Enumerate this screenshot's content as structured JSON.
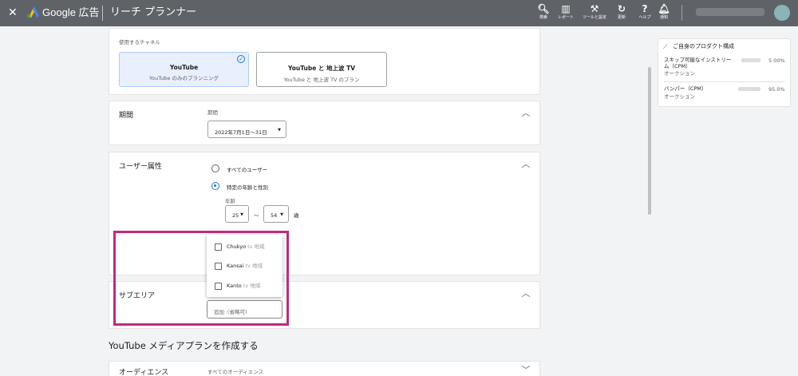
{
  "topbar": {
    "close_icon": "✕",
    "brand": "Google 広告",
    "title": "リーチ プランナー",
    "tools": [
      {
        "icon": "search-icon",
        "glyph": "🔍︎",
        "label": "検索"
      },
      {
        "icon": "reports-icon",
        "glyph": "▥",
        "label": "レポート"
      },
      {
        "icon": "wrench-icon",
        "glyph": "⚒",
        "label": "ツールと設定"
      },
      {
        "icon": "refresh-icon",
        "glyph": "↻",
        "label": "更新"
      },
      {
        "icon": "help-icon",
        "glyph": "?",
        "label": "ヘルプ"
      },
      {
        "icon": "bell-icon",
        "glyph": "🔔︎",
        "label": "通知"
      }
    ]
  },
  "channels": {
    "label": "使用するチャネル",
    "youtube": {
      "title": "YouTube",
      "subtitle": "YouTube のみのプランニング"
    },
    "youtube_tv": {
      "title": "YouTube と 地上波 TV",
      "subtitle": "YouTube と 地上波 TV のプラン"
    }
  },
  "period": {
    "section": "期間",
    "label": "期間",
    "value": "2022年7月1日～31日"
  },
  "demographics": {
    "section": "ユーザー属性",
    "all_users": "すべてのユーザー",
    "specific": "特定の年齢と性別",
    "age_label": "年齢",
    "age_from": "25",
    "age_to": "54",
    "tilde": "～",
    "age_unit": "歳"
  },
  "region_dropdown": {
    "items": [
      {
        "name": "Chukyo",
        "suffix": " tv 地域"
      },
      {
        "name": "Kansai",
        "suffix": " tv 地域"
      },
      {
        "name": "Kanto",
        "suffix": " tv 地域"
      }
    ]
  },
  "subarea": {
    "section": "サブエリア",
    "placeholder": "追加（省略可)"
  },
  "media_plan_heading": "YouTube メディアプランを作成する",
  "audience": {
    "section": "オーディエンス",
    "value": "すべてのオーディエンス"
  },
  "product_mix": {
    "title": "ご自身のプロダクト構成",
    "items": [
      {
        "name": "スキップ可能なインストリーム（CPM）",
        "type": "オークション",
        "percent": "5.00%"
      },
      {
        "name": "バンパー（CPM）",
        "type": "オークション",
        "percent": "95.0%"
      }
    ]
  },
  "colors": {
    "topbar": "#5f6368",
    "selected_channel": "#e8f0fe",
    "accent": "#1a73e8",
    "highlight": "#c2297f"
  }
}
